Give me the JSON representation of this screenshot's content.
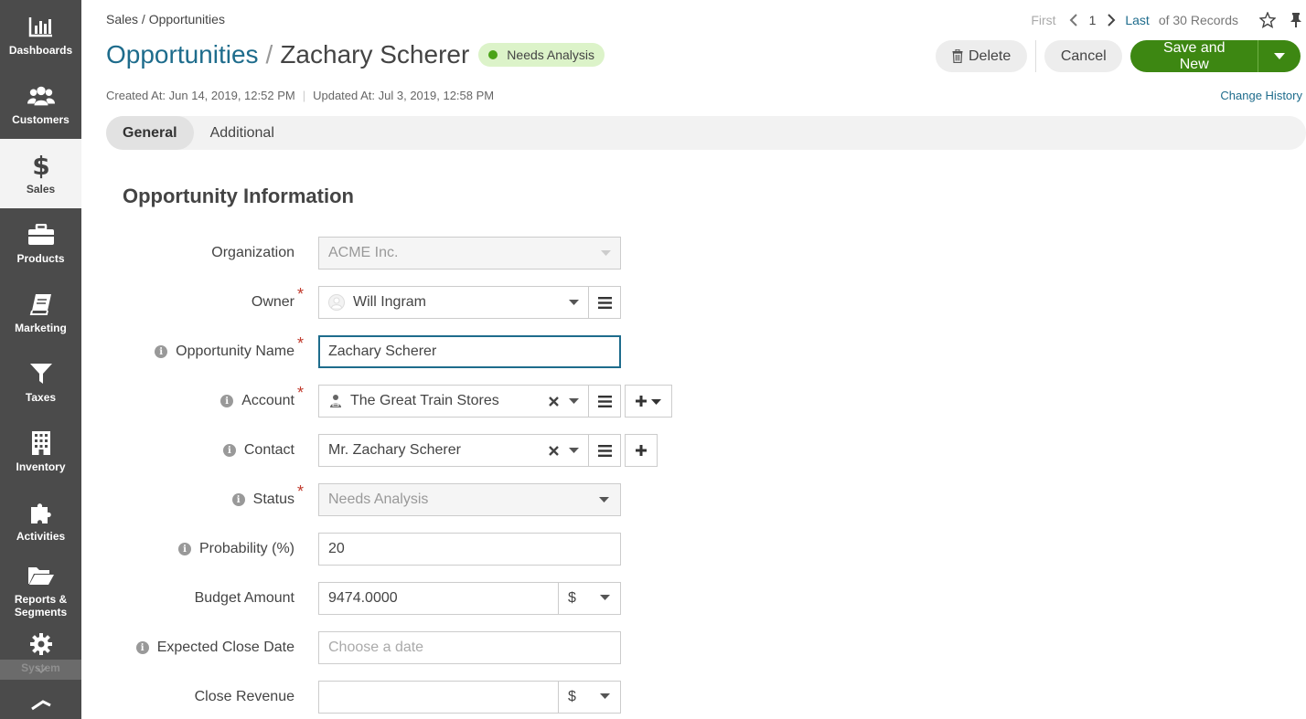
{
  "sidebar": {
    "items": [
      {
        "label": "Dashboards",
        "icon": "bar-chart-icon"
      },
      {
        "label": "Customers",
        "icon": "users-icon"
      },
      {
        "label": "Sales",
        "icon": "dollar-icon",
        "active": true
      },
      {
        "label": "Products",
        "icon": "briefcase-icon"
      },
      {
        "label": "Marketing",
        "icon": "book-icon"
      },
      {
        "label": "Taxes",
        "icon": "filter-icon"
      },
      {
        "label": "Inventory",
        "icon": "building-icon"
      },
      {
        "label": "Activities",
        "icon": "puzzle-icon"
      },
      {
        "label": "Reports & Segments",
        "icon": "folder-open-icon"
      },
      {
        "label": "System",
        "icon": "gear-icon"
      }
    ]
  },
  "breadcrumb": "Sales / Opportunities",
  "pager": {
    "first": "First",
    "page": "1",
    "last": "Last",
    "count": "of 30 Records"
  },
  "title": {
    "entity": "Opportunities",
    "separator": "/",
    "name": "Zachary Scherer",
    "status": "Needs Analysis",
    "status_color": "#4aa317"
  },
  "actions": {
    "delete": "Delete",
    "cancel": "Cancel",
    "save_and_new": "Save and New",
    "accent": "#3d8712"
  },
  "meta": {
    "created": "Created At: Jun 14, 2019, 12:52 PM",
    "updated": "Updated At: Jul 3, 2019, 12:58 PM",
    "change_history": "Change History"
  },
  "tabs": [
    {
      "label": "General",
      "active": true
    },
    {
      "label": "Additional",
      "active": false
    }
  ],
  "section_title": "Opportunity Information",
  "form": {
    "organization": {
      "label": "Organization",
      "value": "ACME Inc."
    },
    "owner": {
      "label": "Owner",
      "value": "Will Ingram"
    },
    "opportunity_name": {
      "label": "Opportunity Name",
      "value": "Zachary Scherer"
    },
    "account": {
      "label": "Account",
      "value": "The Great Train Stores"
    },
    "contact": {
      "label": "Contact",
      "value": "Mr. Zachary Scherer"
    },
    "status": {
      "label": "Status",
      "value": "Needs Analysis"
    },
    "probability": {
      "label": "Probability (%)",
      "value": "20"
    },
    "budget_amount": {
      "label": "Budget Amount",
      "value": "9474.0000",
      "currency": "$"
    },
    "expected_close_date": {
      "label": "Expected Close Date",
      "placeholder": "Choose a date"
    },
    "close_revenue": {
      "label": "Close Revenue",
      "value": "",
      "currency": "$"
    }
  },
  "required_mark": "*",
  "info_mark": "i"
}
